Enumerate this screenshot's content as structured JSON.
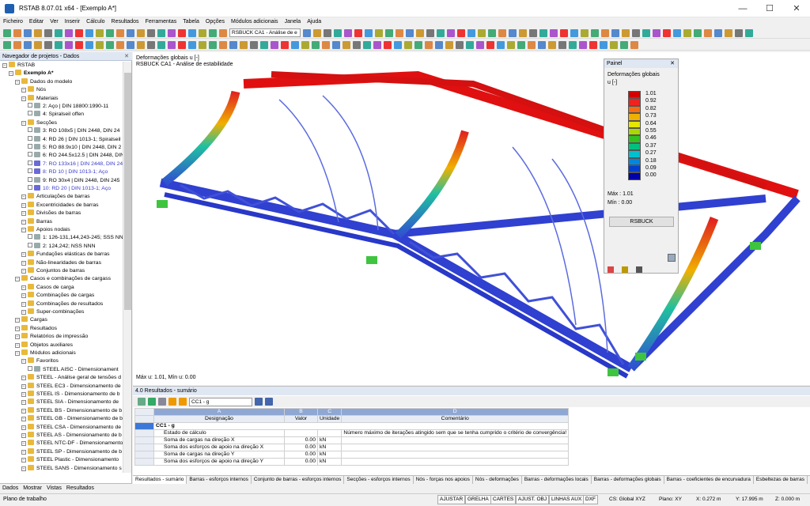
{
  "window": {
    "title": "RSTAB 8.07.01 x64 - [Exemplo A*]",
    "minimize": "—",
    "maximize": "☐",
    "close": "✕"
  },
  "menu": [
    "Ficheiro",
    "Editar",
    "Ver",
    "Inserir",
    "Cálculo",
    "Resultados",
    "Ferramentas",
    "Tabela",
    "Opções",
    "Módulos adicionais",
    "Janela",
    "Ajuda"
  ],
  "toolbar": {
    "loadcase_select": "RSBUCK CA1 - Análise de e"
  },
  "navigator": {
    "title": "Navegador de projetos - Dados",
    "tabs": [
      "Dados",
      "Mostrar",
      "Vistas",
      "Resultados"
    ],
    "items": [
      {
        "t": "RSTAB",
        "l": 0
      },
      {
        "t": "Exemplo A*",
        "l": 1,
        "b": true
      },
      {
        "t": "Dados do modelo",
        "l": 2
      },
      {
        "t": "Nós",
        "l": 3
      },
      {
        "t": "Materiais",
        "l": 3
      },
      {
        "t": "2: Aço | DIN 18800:1990-11",
        "l": 4
      },
      {
        "t": "4: Spiralseil offen",
        "l": 4
      },
      {
        "t": "Secções",
        "l": 3
      },
      {
        "t": "3: RO 108x5 | DIN 2448, DIN 24",
        "l": 4
      },
      {
        "t": "4: RD 26 | DIN 1013-1; Spiralseil",
        "l": 4
      },
      {
        "t": "5: RO 88.9x10 | DIN 2448, DIN 2",
        "l": 4
      },
      {
        "t": "6: RO 244.5x12.5 | DIN 2448, DIN",
        "l": 4
      },
      {
        "t": "7: RO 133x16 | DIN 2448, DIN 24",
        "l": 4,
        "s": true
      },
      {
        "t": "8: RD 10 | DIN 1013-1; Aço",
        "l": 4,
        "s": true
      },
      {
        "t": "9: RO 30x4 | DIN 2448, DIN 245",
        "l": 4
      },
      {
        "t": "10: RD 20 | DIN 1013-1; Aço",
        "l": 4,
        "s": true
      },
      {
        "t": "Articulações de barras",
        "l": 3
      },
      {
        "t": "Excentricidades de barras",
        "l": 3
      },
      {
        "t": "Divisões de barras",
        "l": 3
      },
      {
        "t": "Barras",
        "l": 3
      },
      {
        "t": "Apoios nodais",
        "l": 3
      },
      {
        "t": "1: 126-131,144,243-245; SSS NN",
        "l": 4
      },
      {
        "t": "2: 124,242; NSS NNN",
        "l": 4
      },
      {
        "t": "Fundações elásticas de barras",
        "l": 3
      },
      {
        "t": "Não-linearidades de barras",
        "l": 3
      },
      {
        "t": "Conjuntos de barras",
        "l": 3
      },
      {
        "t": "Casos e combinações de cargass",
        "l": 2
      },
      {
        "t": "Casos de carga",
        "l": 3
      },
      {
        "t": "Combinações de cargas",
        "l": 3
      },
      {
        "t": "Combinações de resultados",
        "l": 3
      },
      {
        "t": "Super-combinações",
        "l": 3
      },
      {
        "t": "Cargas",
        "l": 2
      },
      {
        "t": "Resultados",
        "l": 2
      },
      {
        "t": "Relatórios de impressão",
        "l": 2
      },
      {
        "t": "Objetos auxiliares",
        "l": 2
      },
      {
        "t": "Módulos adicionais",
        "l": 2
      },
      {
        "t": "Favoritos",
        "l": 3
      },
      {
        "t": "STEEL AISC - Dimensionament",
        "l": 4
      },
      {
        "t": "STEEL - Análise geral de tensões d",
        "l": 3
      },
      {
        "t": "STEEL EC3 - Dimensionamento de",
        "l": 3
      },
      {
        "t": "STEEL IS - Dimensionamento de b",
        "l": 3
      },
      {
        "t": "STEEL SIA - Dimensionamento de",
        "l": 3
      },
      {
        "t": "STEEL BS - Dimensionamento de b",
        "l": 3
      },
      {
        "t": "STEEL GB - Dimensionamento de b",
        "l": 3
      },
      {
        "t": "STEEL CSA - Dimensionamento de",
        "l": 3
      },
      {
        "t": "STEEL AS - Dimensionamento de b",
        "l": 3
      },
      {
        "t": "STEEL NTC-DF - Dimensionamento",
        "l": 3
      },
      {
        "t": "STEEL SP - Dimensionamento de b",
        "l": 3
      },
      {
        "t": "STEEL Plastic - Dimensionamento",
        "l": 3
      },
      {
        "t": "STEEL SANS - Dimensionamento s",
        "l": 3
      }
    ]
  },
  "view": {
    "line1": "Deformações globais u [-]",
    "line2": "RSBUCK CA1 - Análise de estabilidade",
    "maxmin": "Máx u: 1.01, Mín u: 0.00"
  },
  "panel": {
    "title": "Painel",
    "label": "Deformações globais",
    "unit": "u [-]",
    "scale": [
      {
        "v": "1.01",
        "c": "#d40000"
      },
      {
        "v": "0.92",
        "c": "#f22020"
      },
      {
        "v": "0.82",
        "c": "#f76b10"
      },
      {
        "v": "0.73",
        "c": "#f0b000"
      },
      {
        "v": "0.64",
        "c": "#e6e600"
      },
      {
        "v": "0.55",
        "c": "#a8d800"
      },
      {
        "v": "0.46",
        "c": "#30c020"
      },
      {
        "v": "0.37",
        "c": "#00c080"
      },
      {
        "v": "0.27",
        "c": "#00c0d0"
      },
      {
        "v": "0.18",
        "c": "#0088e0"
      },
      {
        "v": "0.09",
        "c": "#0040d0"
      },
      {
        "v": "0.00",
        "c": "#0000a8"
      }
    ],
    "max_label": "Máx :",
    "max_value": "1.01",
    "min_label": "Mín :",
    "min_value": "0.00",
    "button": "RSBUCK"
  },
  "results": {
    "title": "4.0 Resultados - sumário",
    "case_select": "CC1 - g",
    "col_letters": [
      "A",
      "B",
      "C",
      "D"
    ],
    "col_names": [
      "Designação",
      "Valor",
      "Unidade",
      "Comentário"
    ],
    "group": "CC1 - g",
    "rows": [
      {
        "d": "Estado de cálculo",
        "v": "",
        "u": "",
        "c": "Número máximo de iterações atingido sem que se tenha cumprido o critério de convergência!"
      },
      {
        "d": "Soma de cargas na direção X",
        "v": "0.00",
        "u": "kN",
        "c": ""
      },
      {
        "d": "Soma dos esforços de apoio na direção X",
        "v": "0.00",
        "u": "kN",
        "c": ""
      },
      {
        "d": "Soma de cargas na direção Y",
        "v": "0.00",
        "u": "kN",
        "c": ""
      },
      {
        "d": "Soma dos esforços de apoio na direção Y",
        "v": "0.00",
        "u": "kN",
        "c": ""
      }
    ],
    "tabs": [
      "Resultados - sumário",
      "Barras - esforços internos",
      "Conjunto de barras - esforços internos",
      "Secções - esforços internos",
      "Nós - forças nos apoios",
      "Nós - deformações",
      "Barras - deformações locais",
      "Barras - deformações globais",
      "Barras - coeficientes de encurvadura",
      "Esbeltezas de barras"
    ]
  },
  "status": {
    "text": "Plano de trabalho",
    "buttons": [
      "AJUSTAR",
      "GRELHA",
      "CARTES",
      "AJUST. OBJ",
      "LINHAS AUX",
      "DXF"
    ],
    "cs": "CS: Global XYZ",
    "plane": "Plano: XY",
    "x": "X: 0.272 m",
    "y": "Y: 17.995 m",
    "z": "Z: 0.000 m"
  }
}
